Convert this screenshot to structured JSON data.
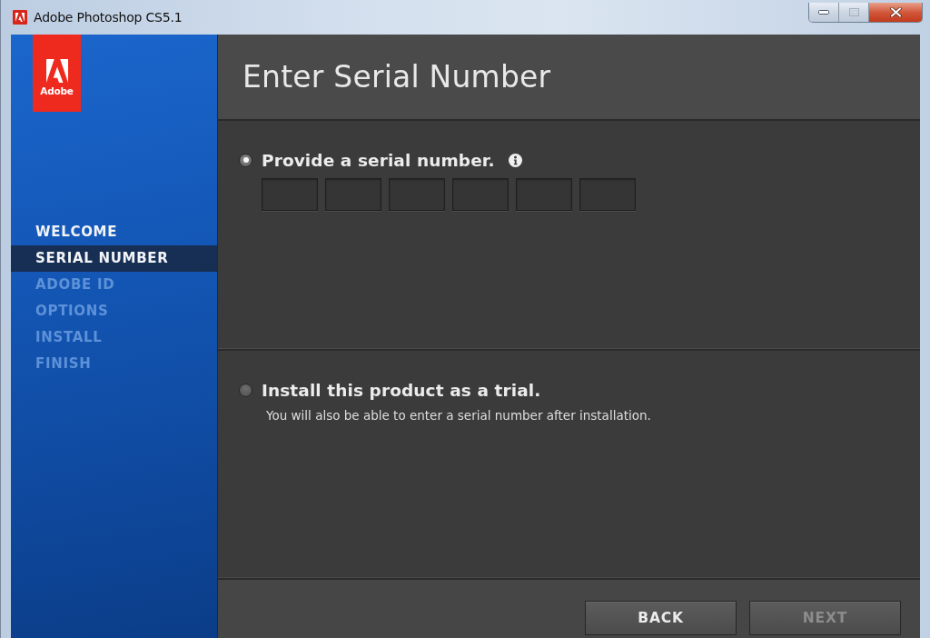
{
  "window": {
    "title": "Adobe Photoshop CS5.1"
  },
  "logo": {
    "text": "Adobe"
  },
  "sidebar": {
    "items": [
      {
        "label": "WELCOME",
        "selected": false,
        "disabled": false
      },
      {
        "label": "SERIAL NUMBER",
        "selected": true,
        "disabled": false
      },
      {
        "label": "ADOBE ID",
        "selected": false,
        "disabled": true
      },
      {
        "label": "OPTIONS",
        "selected": false,
        "disabled": true
      },
      {
        "label": "INSTALL",
        "selected": false,
        "disabled": true
      },
      {
        "label": "FINISH",
        "selected": false,
        "disabled": true
      }
    ]
  },
  "header": {
    "title": "Enter Serial Number"
  },
  "options": [
    {
      "label": "Provide a serial number.",
      "selected": true,
      "info": true,
      "fields": [
        {
          "kind": "text-box"
        },
        {
          "kind": "text-box"
        },
        {
          "kind": "text-box"
        },
        {
          "kind": "text-box"
        },
        {
          "kind": "text-box"
        },
        {
          "kind": "text-box"
        }
      ]
    },
    {
      "label": "Install this product as a trial.",
      "selected": false,
      "note": "You will also be able to enter a serial number after installation."
    }
  ],
  "buttons": [
    {
      "label": "BACK",
      "disabled": false
    },
    {
      "label": "NEXT",
      "disabled": true
    }
  ]
}
